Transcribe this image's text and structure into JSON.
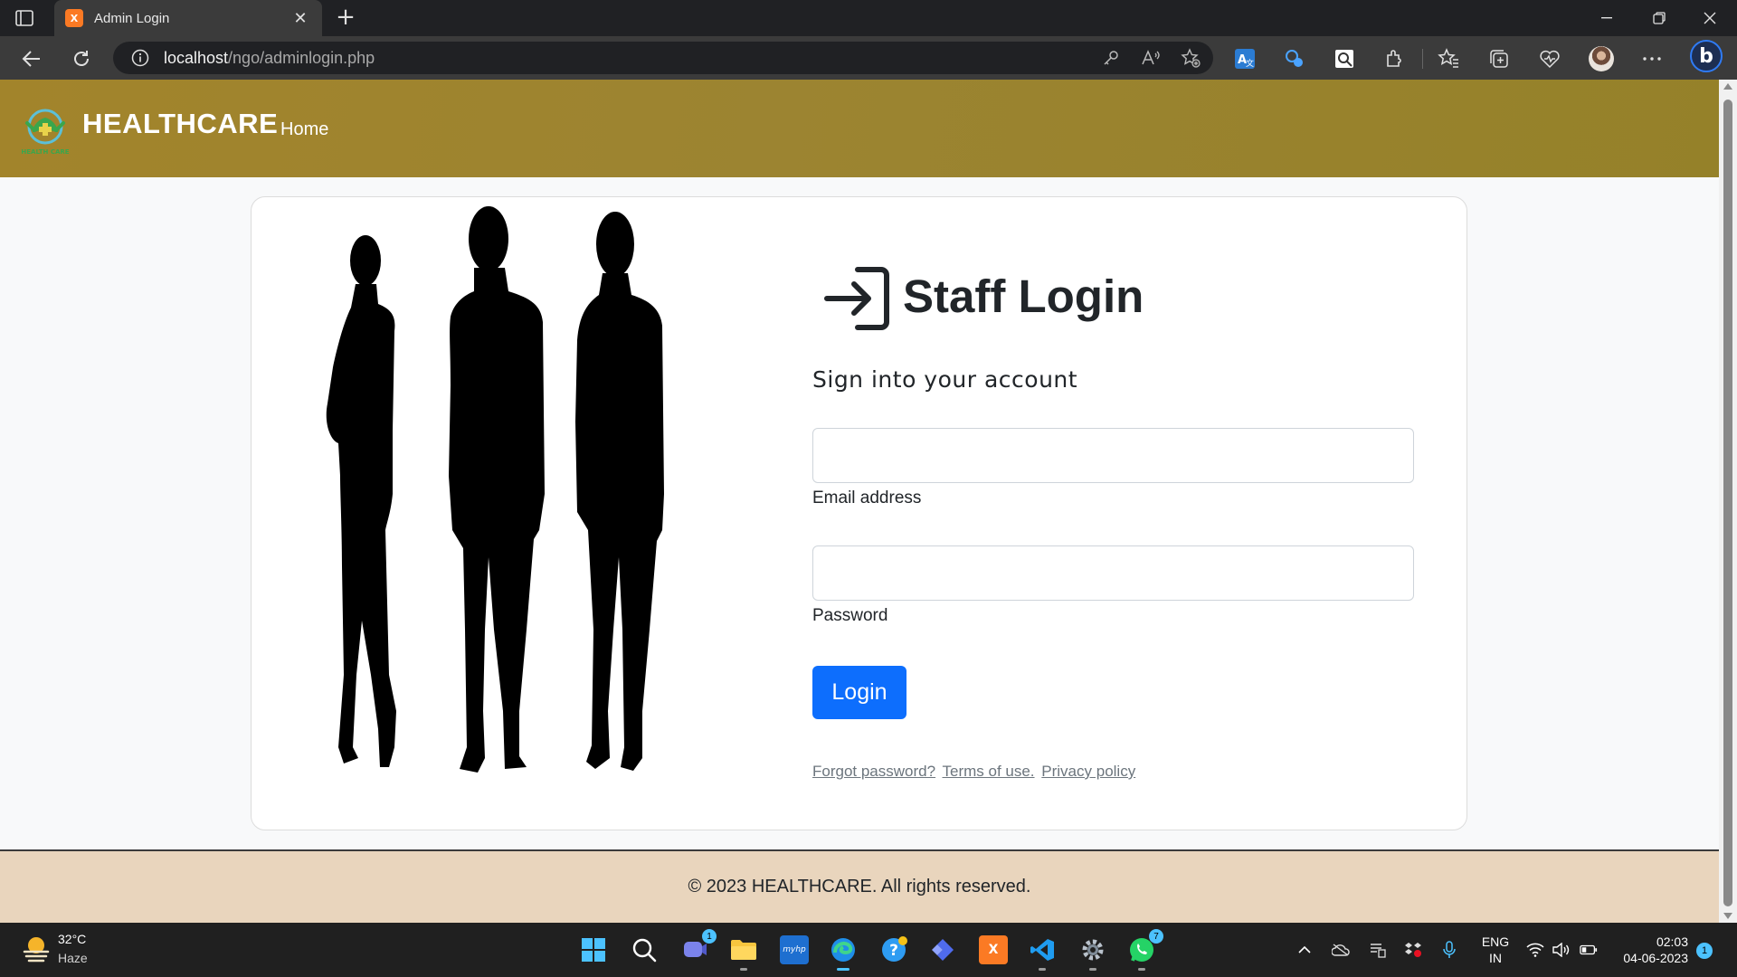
{
  "browser": {
    "tab_title": "Admin Login",
    "favicon_text": "X",
    "address_host": "localhost",
    "address_path": "/ngo/adminlogin.php",
    "avatar_label": "profile"
  },
  "site": {
    "brand": "HEALTHCARE",
    "logo_text": "HEALTH CARE",
    "nav": [
      {
        "label": "Home"
      }
    ]
  },
  "login": {
    "title": "Staff Login",
    "subtitle": "Sign into your account",
    "email_label": "Email address",
    "email_value": "",
    "password_label": "Password",
    "password_value": "",
    "button_label": "Login",
    "links": [
      "Forgot password?",
      "Terms of use.",
      "Privacy policy"
    ]
  },
  "footer": {
    "text": "© 2023 HEALTHCARE. All rights reserved."
  },
  "taskbar": {
    "weather_temp": "32°C",
    "weather_desc": "Haze",
    "teams_badge": "1",
    "whatsapp_badge": "7",
    "lang_line1": "ENG",
    "lang_line2": "IN",
    "time": "02:03",
    "date": "04-06-2023",
    "notification_count": "1",
    "app_labels": {
      "hp": "myhp",
      "xampp": "X"
    }
  },
  "colors": {
    "navbar": "#9c8431",
    "primary_button": "#0d6efd",
    "footer": "#e9d5bd",
    "chrome": "#3b3b3b",
    "taskbar": "#202020"
  }
}
